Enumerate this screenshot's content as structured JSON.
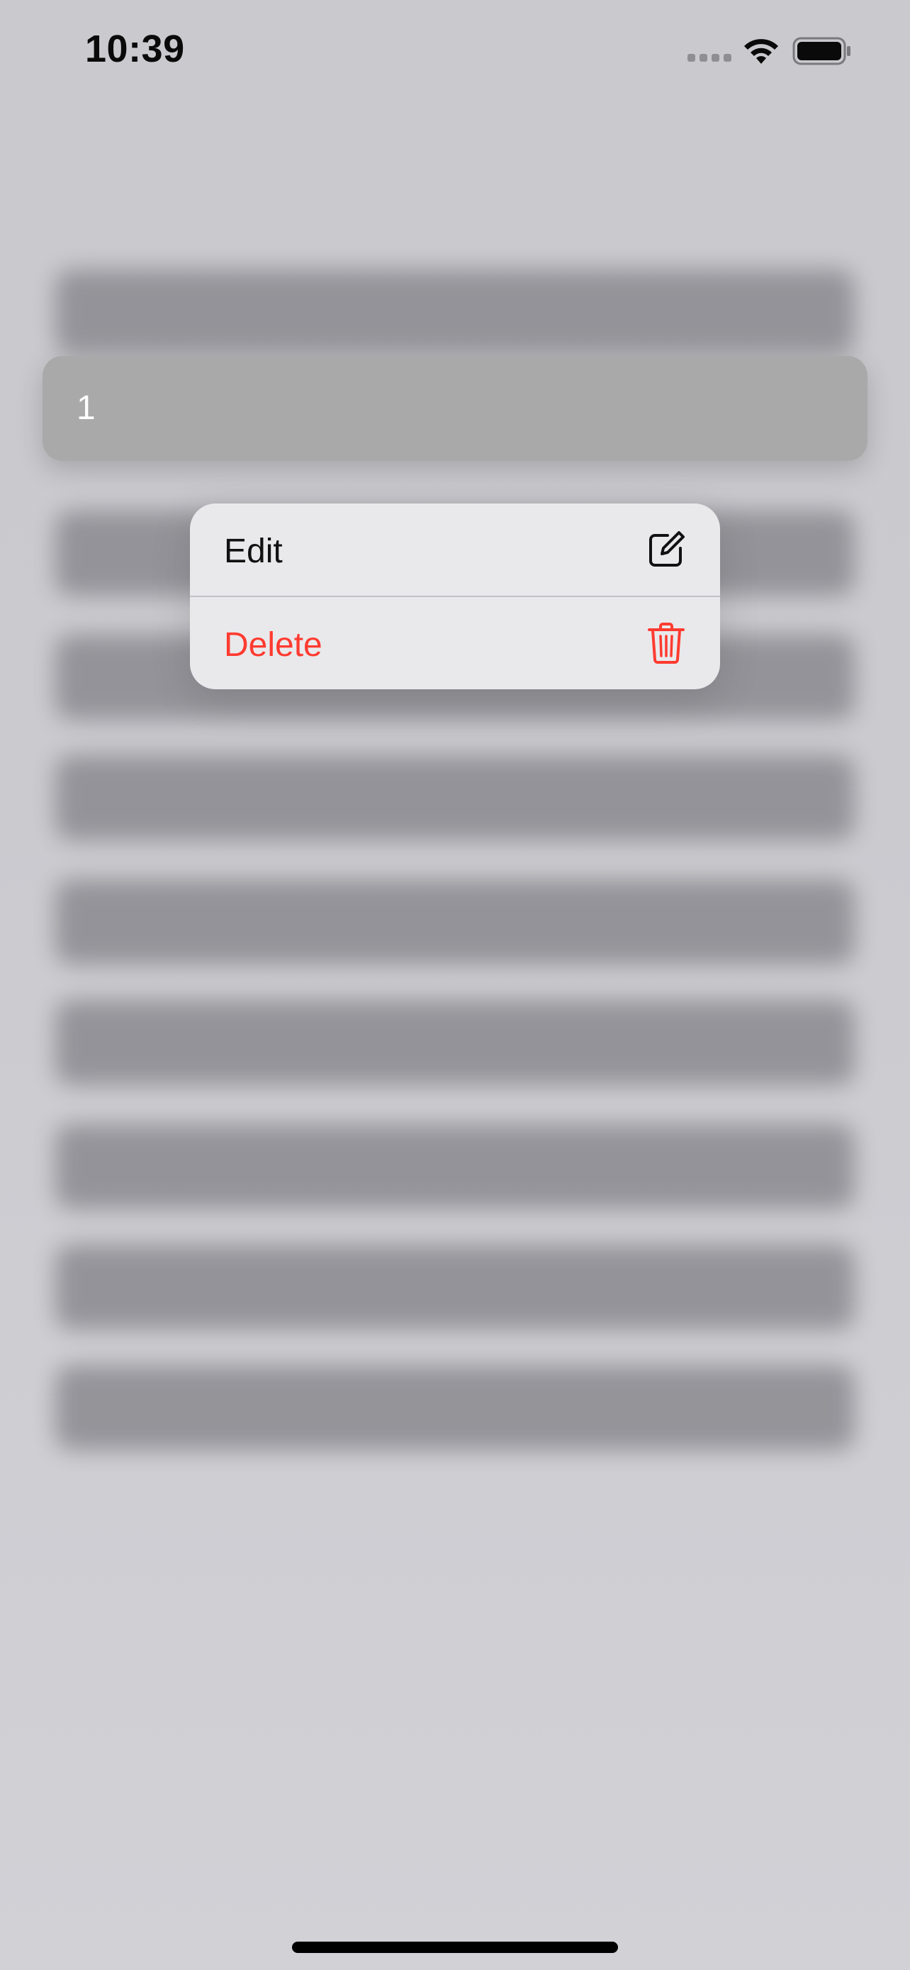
{
  "status_bar": {
    "time": "10:39",
    "signal_icon": "cellular-signal-icon",
    "wifi_icon": "wifi-icon",
    "battery_icon": "battery-full-icon"
  },
  "list": {
    "focused_cell_label": "1"
  },
  "context_menu": {
    "items": [
      {
        "label": "Edit",
        "icon": "square-and-pencil-icon",
        "color": "#111111"
      },
      {
        "label": "Delete",
        "icon": "trash-icon",
        "color": "#ff3b30"
      }
    ]
  },
  "colors": {
    "background": "#cdcdd2",
    "focused_cell": "#a9a9a9",
    "menu_background": "#e9e9eb",
    "destructive": "#ff3b30"
  }
}
